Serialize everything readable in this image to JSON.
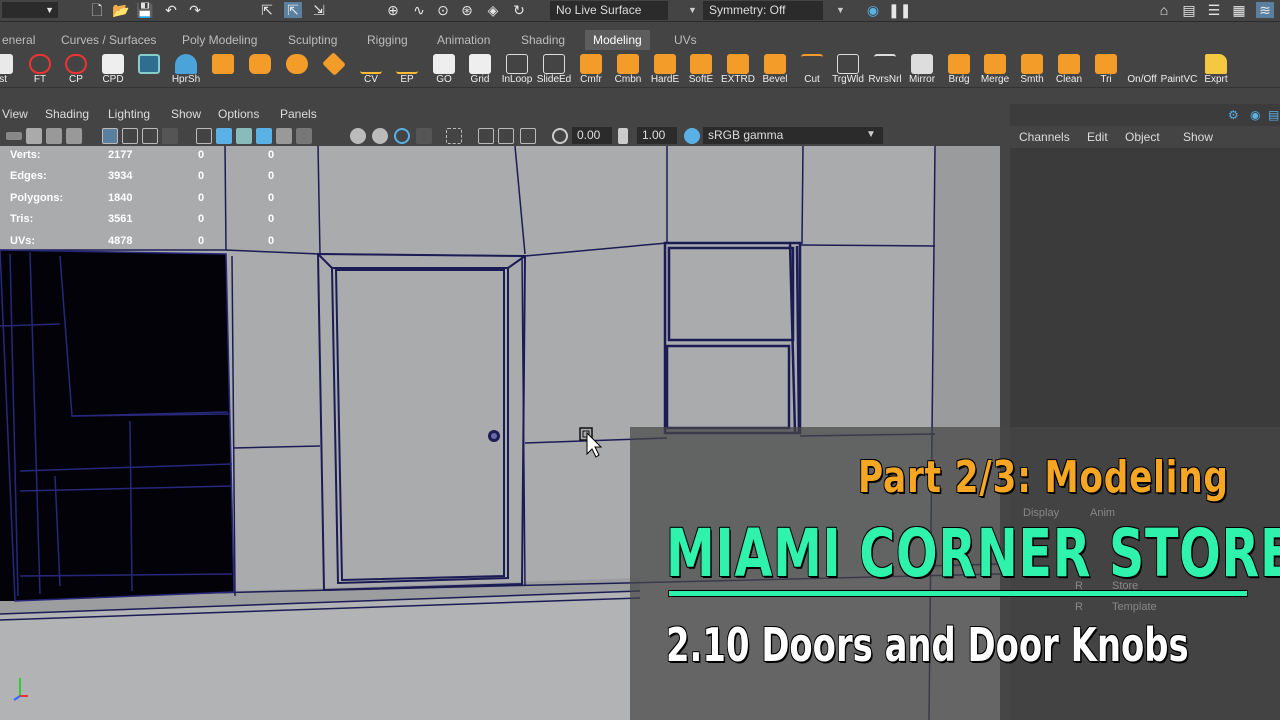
{
  "status_line": {
    "live_surface": "No Live Surface",
    "symmetry": "Symmetry: Off"
  },
  "shelf_tabs": [
    "eneral",
    "Curves / Surfaces",
    "Poly Modeling",
    "Sculpting",
    "Rigging",
    "Animation",
    "Shading",
    "Modeling",
    "UVs"
  ],
  "active_shelf_tab": "Modeling",
  "shelf_buttons": [
    "ist",
    "FT",
    "CP",
    "CPD",
    "",
    "HprSh",
    "",
    "",
    "",
    "",
    "CV",
    "EP",
    "GO",
    "Grid",
    "InLoop",
    "SlideEd",
    "Cmfr",
    "Cmbn",
    "HardE",
    "SoftE",
    "EXTRD",
    "Bevel",
    "Cut",
    "TrgWld",
    "RvrsNrl",
    "Mirror",
    "Brdg",
    "Merge",
    "Smth",
    "Clean",
    "Tri",
    "On/Off",
    "PaintVC",
    "Exprt"
  ],
  "viewport_menu": [
    "View",
    "Shading",
    "Lighting",
    "Show",
    "Options",
    "Panels"
  ],
  "viewport_toolbar": {
    "exposure": "0.00",
    "gamma": "1.00",
    "color_space": "sRGB gamma"
  },
  "hud": [
    {
      "label": "Verts:",
      "a": "2177",
      "b": "0",
      "c": "0"
    },
    {
      "label": "Edges:",
      "a": "3934",
      "b": "0",
      "c": "0"
    },
    {
      "label": "Polygons:",
      "a": "1840",
      "b": "0",
      "c": "0"
    },
    {
      "label": "Tris:",
      "a": "3561",
      "b": "0",
      "c": "0"
    },
    {
      "label": "UVs:",
      "a": "4878",
      "b": "0",
      "c": "0"
    }
  ],
  "channel_box_menu": [
    "Channels",
    "Edit",
    "Object",
    "Show"
  ],
  "layer_editor": {
    "tabs": [
      "Display",
      "Anim"
    ],
    "layers": [
      {
        "flag": "R",
        "name": "Store"
      },
      {
        "flag": "R",
        "name": "Template"
      }
    ]
  },
  "overlay": {
    "part": "Part 2/3: Modeling",
    "store": "MIAMI CORNER STORE",
    "lesson": "2.10 Doors and Door Knobs"
  },
  "colors": {
    "accent_green": "#2ff2ad",
    "accent_orange": "#f5a623",
    "wireframe": "#1a1a6e",
    "viewport_bg": "#aaabad"
  }
}
